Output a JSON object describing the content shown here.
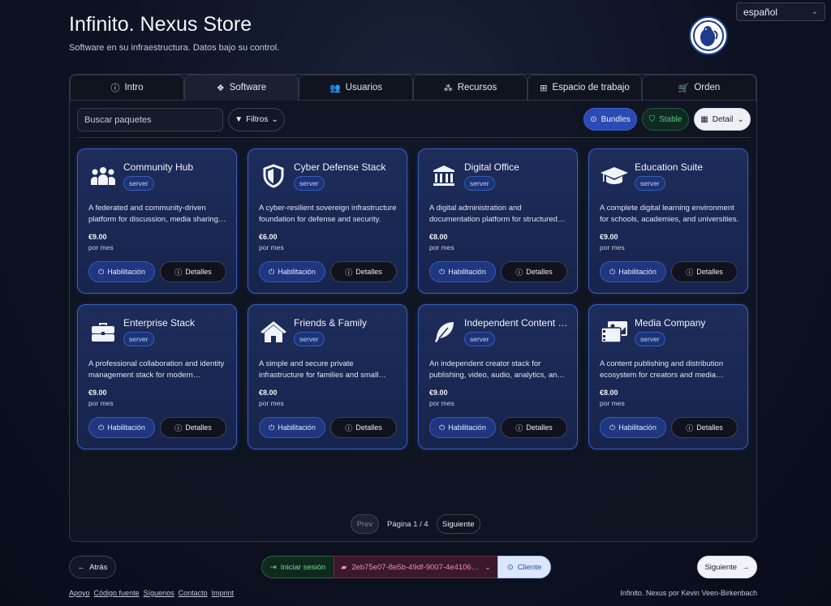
{
  "header": {
    "title": "Infinito. Nexus Store",
    "subtitle": "Software en su infraestructura. Datos bajo su control.",
    "language": "español",
    "logo_icon": "seal-logo-icon"
  },
  "tabs": [
    {
      "label": "Intro",
      "icon": "info-icon",
      "active": false
    },
    {
      "label": "Software",
      "icon": "cubes-icon",
      "active": true
    },
    {
      "label": "Usuarios",
      "icon": "users-icon",
      "active": false
    },
    {
      "label": "Recursos",
      "icon": "pyramid-icon",
      "active": false
    },
    {
      "label": "Espacio de trabajo",
      "icon": "sitemap-icon",
      "active": false
    },
    {
      "label": "Orden",
      "icon": "cart-icon",
      "active": false
    }
  ],
  "toolbar": {
    "search_placeholder": "Buscar paquetes",
    "filter_label": "Filtros",
    "bundles_label": "Bundles",
    "stable_label": "Stable",
    "detail_label": "Detail"
  },
  "cards": [
    {
      "name": "Community Hub",
      "tag": "server",
      "icon": "users-group-icon",
      "desc": "A federated and community-driven platform for discussion, media sharing and collaboration.",
      "price": "€9.00",
      "period": "por mes",
      "enable_label": "Habilitación",
      "details_label": "Detalles"
    },
    {
      "name": "Cyber Defense Stack",
      "tag": "server",
      "icon": "shield-icon",
      "desc": "A cyber-resilient sovereign infrastructure foundation for defense and security.",
      "price": "€6.00",
      "period": "por mes",
      "enable_label": "Habilitación",
      "details_label": "Detalles"
    },
    {
      "name": "Digital Office",
      "tag": "server",
      "icon": "bank-icon",
      "desc": "A digital administration and documentation platform for structured office work.",
      "price": "€8.00",
      "period": "por mes",
      "enable_label": "Habilitación",
      "details_label": "Detalles"
    },
    {
      "name": "Education Suite",
      "tag": "server",
      "icon": "graduation-cap-icon",
      "desc": "A complete digital learning environment for schools, academies, and universities.",
      "price": "€9.00",
      "period": "por mes",
      "enable_label": "Habilitación",
      "details_label": "Detalles"
    },
    {
      "name": "Enterprise Stack",
      "tag": "server",
      "icon": "briefcase-icon",
      "desc": "A professional collaboration and identity management stack for modern enterprises.",
      "price": "€9.00",
      "period": "por mes",
      "enable_label": "Habilitación",
      "details_label": "Detalles"
    },
    {
      "name": "Friends & Family",
      "tag": "server",
      "icon": "house-icon",
      "desc": "A simple and secure private infrastructure for families and small groups.",
      "price": "€8.00",
      "period": "por mes",
      "enable_label": "Habilitación",
      "details_label": "Detalles"
    },
    {
      "name": "Independent Content Creator",
      "tag": "server",
      "icon": "feather-icon",
      "desc": "An independent creator stack for publishing, video, audio, analytics, and more.",
      "price": "€9.00",
      "period": "por mes",
      "enable_label": "Habilitación",
      "details_label": "Detalles"
    },
    {
      "name": "Media Company",
      "tag": "server",
      "icon": "photo-film-icon",
      "desc": "A content publishing and distribution ecosystem for creators and media houses.",
      "price": "€8.00",
      "period": "por mes",
      "enable_label": "Habilitación",
      "details_label": "Detalles"
    }
  ],
  "pager": {
    "prev": "Prev",
    "info": "Página 1 / 4",
    "next": "Siguiente"
  },
  "bottom": {
    "back_label": "Atrás",
    "login_label": "Iniciar sesión",
    "workspace_id": "2eb75e07-8e5b-49df-9007-4e4106…",
    "client_label": "Cliente",
    "next_label": "Siguiente"
  },
  "footer": {
    "links": [
      "Apoyo",
      "Código fuente",
      "Síguenos",
      "Contacto",
      "Imprint"
    ],
    "credit": "Infinito. Nexus por Kevin Veen-Birkenbach"
  },
  "colors": {
    "accent": "#2a4bb3",
    "card_border": "#3b5fc0",
    "stable": "#56c78a",
    "workspace": "#f08ab3"
  }
}
